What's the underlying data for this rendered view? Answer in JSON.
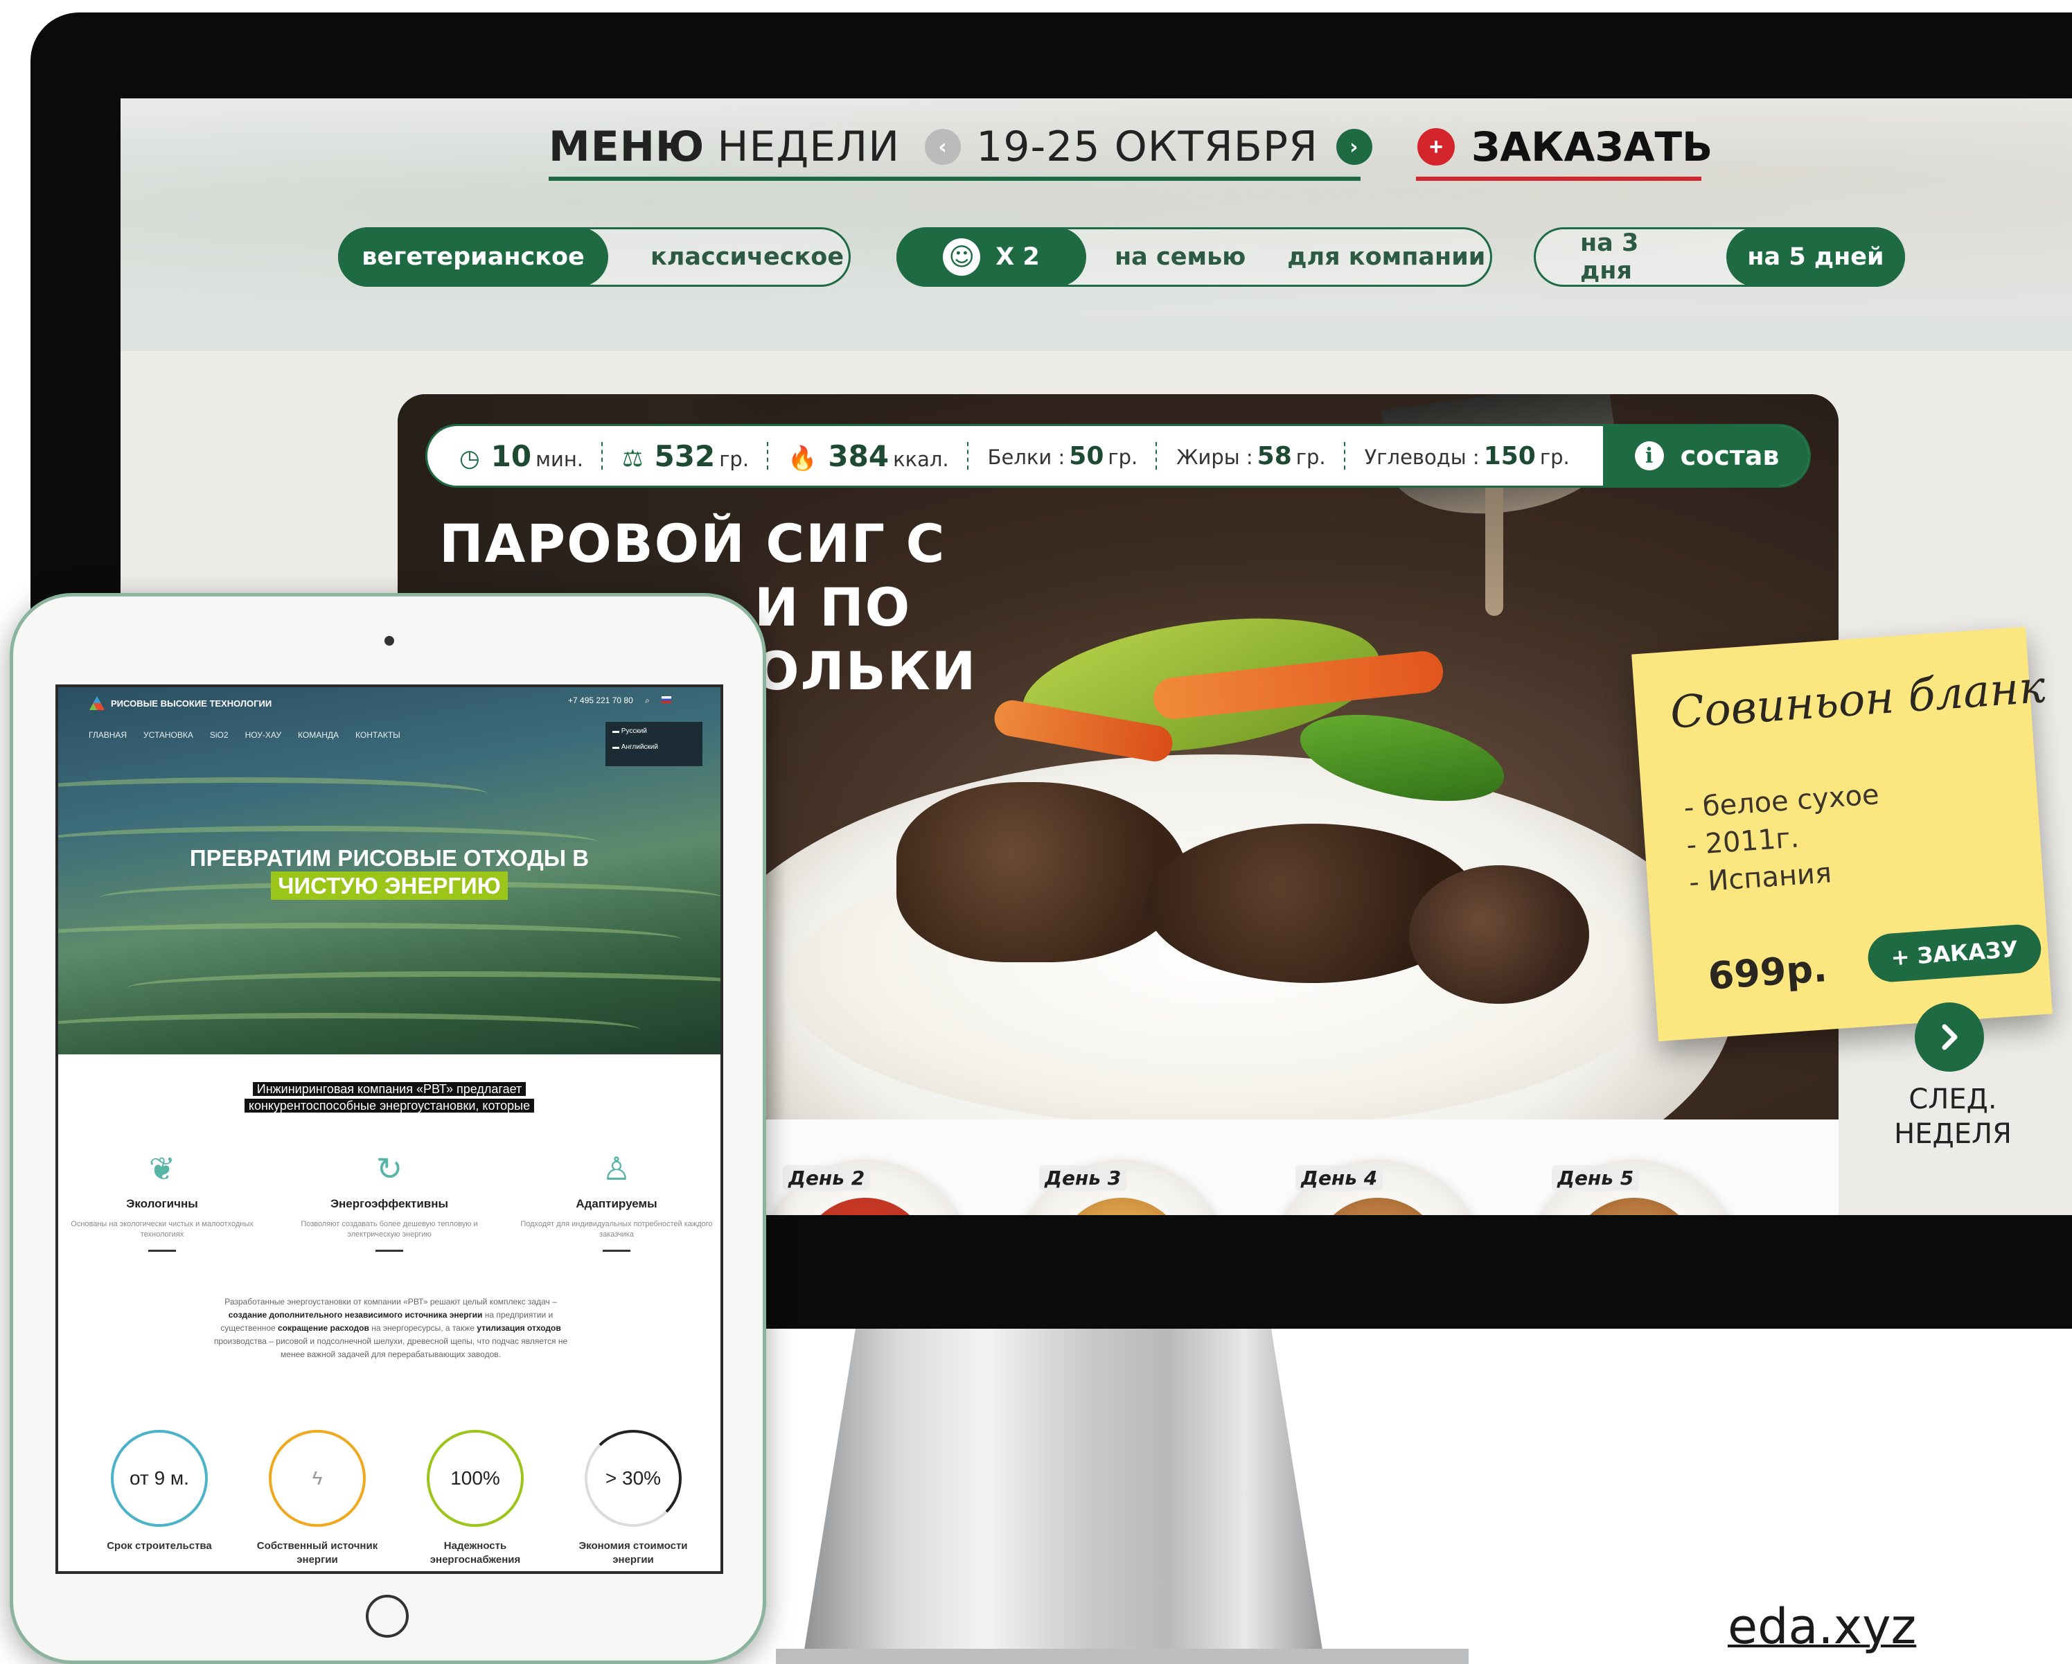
{
  "desktop": {
    "header": {
      "title_bold": "МЕНЮ",
      "title_rest": "НЕДЕЛИ",
      "date_range": "19-25 ОКТЯБРЯ",
      "order_label": "ЗАКАЗАТЬ"
    },
    "filters": {
      "diet": [
        "вегетерианское",
        "классическое"
      ],
      "portions": [
        "X 2",
        "на семью",
        "для компании"
      ],
      "duration": [
        "на 3 дня",
        "на 5 дней"
      ]
    },
    "dish": {
      "time_value": "10",
      "time_unit": "мин.",
      "weight_value": "532",
      "weight_unit": "гр.",
      "kcal_value": "384",
      "kcal_unit": "ккал.",
      "protein_label": "Белки :",
      "protein_value": "50",
      "protein_unit": "гр.",
      "fat_label": "Жиры :",
      "fat_value": "58",
      "fat_unit": "гр.",
      "carbs_label": "Углеводы :",
      "carbs_value": "150",
      "carbs_unit": "гр.",
      "composition_label": "состав",
      "title_line1": "ПАРОВОЙ СИГ С",
      "title_line2": "И ПО",
      "title_line3": "ОЛЬКИ"
    },
    "wine": {
      "name": "Совиньон бланк",
      "details": [
        "- белое сухое",
        "- 2011г.",
        "- Испания"
      ],
      "price": "699р.",
      "order_label": "+ ЗАКАЗУ"
    },
    "days": [
      "День 2",
      "День 3",
      "День 4",
      "День 5"
    ],
    "next_week": {
      "line1": "СЛЕД.",
      "line2": "НЕДЕЛЯ"
    }
  },
  "tablet": {
    "company": "РИСОВЫЕ ВЫСОКИЕ ТЕХНОЛОГИИ",
    "phone": "+7 495 221 70 80",
    "nav": [
      "ГЛАВНАЯ",
      "УСТАНОВКА",
      "SiO2",
      "НОУ-ХАУ",
      "КОМАНДА",
      "КОНТАКТЫ"
    ],
    "languages": [
      "Русский",
      "Английский"
    ],
    "hero_line1": "ПРЕВРАТИМ РИСОВЫЕ ОТХОДЫ В",
    "hero_highlight": "ЧИСТУЮ ЭНЕРГИЮ",
    "intro_line1": "Инжиниринговая компания «РВТ» предлагает",
    "intro_line2": "конкурентоспособные энергоустановки, которые",
    "features": [
      {
        "title": "Экологичны",
        "desc": "Основаны на экологически чистых и малоотходных технологиях"
      },
      {
        "title": "Энергоэффективны",
        "desc": "Позволяют создавать более дешевую тепловую и электрическую энергию"
      },
      {
        "title": "Адаптируемы",
        "desc": "Подходят для индивидуальных потребностей каждого заказчика"
      }
    ],
    "paragraph": {
      "p1": "Разработанные энергоустановки от компании «РВТ» решают целый комплекс задач –",
      "b1": "создание дополнительного независимого источника энергии",
      "p2": "на предприятии и существенное",
      "b2": "сокращение расходов",
      "p3": "на энергоресурсы, а также",
      "b3": "утилизация отходов",
      "p4": "производства – рисовой и подсолнечной шелухи, древесной щепы, что подчас является не менее важной задачей для перерабатывающих заводов."
    },
    "stats": [
      {
        "value": "от 9 м.",
        "caption": "Срок строительства",
        "color": "#4bb3c7"
      },
      {
        "value": "",
        "caption": "Собственный источник энергии",
        "color": "#f0a91e"
      },
      {
        "value": "100%",
        "caption": "Надежность энергоснабжения",
        "color": "#9cc51a"
      },
      {
        "value": "> 30%",
        "caption": "Экономия стоимости энергии",
        "color": "#222222"
      }
    ]
  },
  "watermark": "eda.xyz",
  "colors": {
    "brand_green": "#1e6b43",
    "order_red": "#d5252c",
    "sticky_yellow": "#fbe680",
    "highlight_green": "#9cc51a"
  }
}
